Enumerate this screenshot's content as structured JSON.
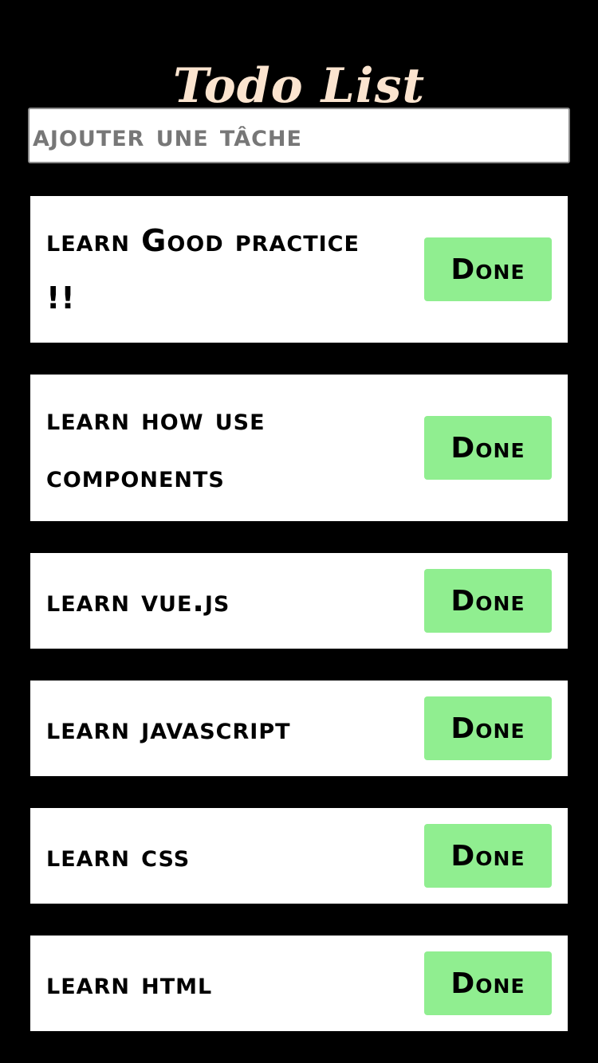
{
  "header": {
    "title": "Todo List"
  },
  "input": {
    "placeholder": "ajouter une tâche",
    "value": ""
  },
  "todos": [
    {
      "text": "learn Good practice !!",
      "button_label": "Done"
    },
    {
      "text": "learn how use components",
      "button_label": "Done"
    },
    {
      "text": "learn vue.js",
      "button_label": "Done"
    },
    {
      "text": "learn javascript",
      "button_label": "Done"
    },
    {
      "text": "learn css",
      "button_label": "Done"
    },
    {
      "text": "learn html",
      "button_label": "Done"
    }
  ],
  "colors": {
    "background": "#000000",
    "title": "#fbe4cf",
    "card": "#ffffff",
    "done_button": "#90ee90",
    "placeholder": "#777777"
  }
}
